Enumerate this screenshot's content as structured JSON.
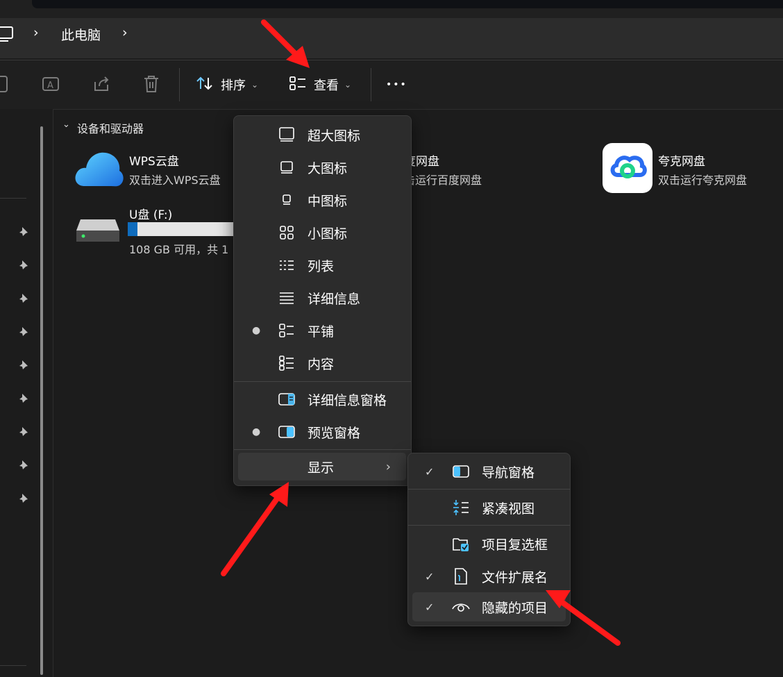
{
  "breadcrumb": {
    "location": "此电脑",
    "separator": "›"
  },
  "toolbar": {
    "sort_label": "排序",
    "view_label": "查看",
    "more_label": "•••"
  },
  "content": {
    "section_title": "设备和驱动器",
    "drives": [
      {
        "name": "WPS云盘",
        "desc": "双击进入WPS云盘"
      },
      {
        "name": "度网盘",
        "desc": "击运行百度网盘"
      },
      {
        "name": "夸克网盘",
        "desc": "双击运行夸克网盘"
      },
      {
        "name": "U盘 (F:)",
        "desc": "108 GB 可用，共 1",
        "usage_fraction": 0.08
      }
    ]
  },
  "view_menu": {
    "items": [
      {
        "label": "超大图标",
        "icon": "extra-large-icons-icon",
        "selected": false
      },
      {
        "label": "大图标",
        "icon": "large-icons-icon",
        "selected": false
      },
      {
        "label": "中图标",
        "icon": "medium-icons-icon",
        "selected": false
      },
      {
        "label": "小图标",
        "icon": "small-icons-icon",
        "selected": false
      },
      {
        "label": "列表",
        "icon": "list-icon",
        "selected": false
      },
      {
        "label": "详细信息",
        "icon": "details-icon",
        "selected": false
      },
      {
        "label": "平铺",
        "icon": "tiles-icon",
        "selected": true
      },
      {
        "label": "内容",
        "icon": "content-icon",
        "selected": false
      }
    ],
    "panes": [
      {
        "label": "详细信息窗格",
        "icon": "details-pane-icon",
        "selected": false
      },
      {
        "label": "预览窗格",
        "icon": "preview-pane-icon",
        "selected": true
      }
    ],
    "show_label": "显示"
  },
  "show_menu": {
    "items": [
      {
        "label": "导航窗格",
        "icon": "navigation-pane-icon",
        "checked": true
      },
      {
        "label": "紧凑视图",
        "icon": "compact-view-icon",
        "checked": false
      },
      {
        "label": "项目复选框",
        "icon": "item-checkbox-icon",
        "checked": false
      },
      {
        "label": "文件扩展名",
        "icon": "file-extension-icon",
        "checked": true
      },
      {
        "label": "隐藏的项目",
        "icon": "hidden-items-icon",
        "checked": true
      }
    ]
  },
  "colors": {
    "accent": "#4cc2ff",
    "annotation_arrow": "#ff1a1a",
    "drive_bar": "#0f6cbd"
  }
}
